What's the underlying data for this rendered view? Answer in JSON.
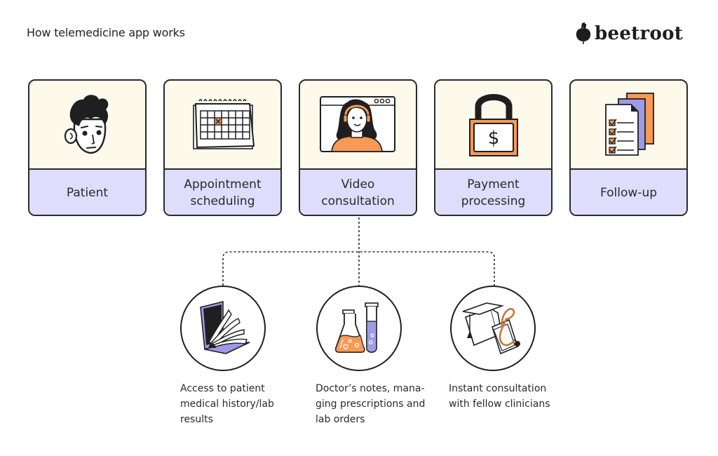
{
  "header": {
    "title": "How telemedicine app works",
    "logo_text": "beetroot"
  },
  "colors": {
    "card_top_bg": "#fdf9eb",
    "card_label_bg": "#e0dcfb",
    "accent_orange": "#f79a55",
    "accent_purple": "#9f9ae6",
    "outline": "#2a2a2a"
  },
  "steps": [
    {
      "label": "Patient",
      "icon": "patient-face-icon"
    },
    {
      "label": "Appointment\nscheduling",
      "icon": "calendar-icon"
    },
    {
      "label": "Video\nconsultation",
      "icon": "video-call-icon"
    },
    {
      "label": "Payment\nprocessing",
      "icon": "padlock-dollar-icon"
    },
    {
      "label": "Follow-up",
      "icon": "checklist-documents-icon"
    }
  ],
  "sub_features": [
    {
      "label": "Access to patient\nmedical history/lab\nresults",
      "icon": "laptop-book-icon"
    },
    {
      "label": "Doctor’s notes, mana-\nging prescriptions and\nlab orders",
      "icon": "lab-flask-icon"
    },
    {
      "label": "Instant consultation\nwith fellow clinicians",
      "icon": "graduation-stethoscope-icon"
    }
  ]
}
